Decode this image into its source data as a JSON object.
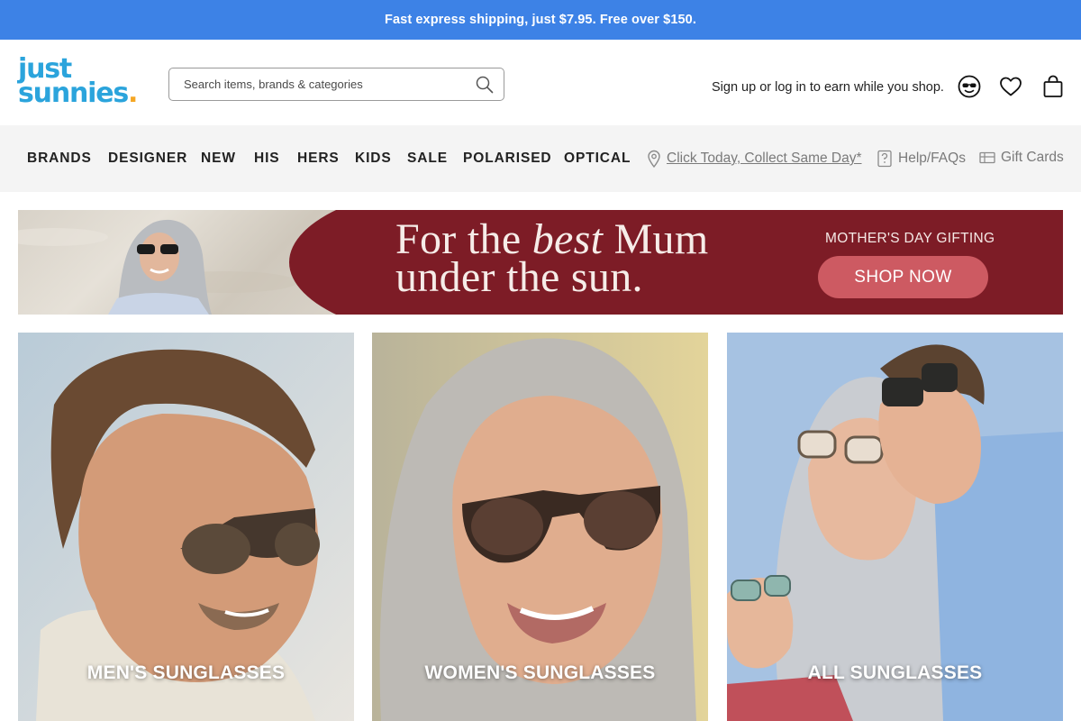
{
  "promo": {
    "text": "Fast express shipping, just $7.95. Free over $150."
  },
  "header": {
    "logo": {
      "line1": "just",
      "line2": "sunnies",
      "dot": "."
    },
    "search": {
      "placeholder": "Search items, brands & categories",
      "value": ""
    },
    "signup_text": "Sign up or log in to earn while you shop.",
    "icons": [
      "account-icon",
      "heart-icon",
      "bag-icon"
    ]
  },
  "nav": {
    "items": [
      "BRANDS",
      "DESIGNER",
      "NEW",
      "HIS",
      "HERS",
      "KIDS",
      "SALE",
      "POLARISED",
      "OPTICAL"
    ],
    "utility": [
      {
        "label": "Click Today, Collect Same Day*",
        "icon": "location-pin-icon"
      },
      {
        "label": "Help/FAQs",
        "icon": "help-doc-icon"
      },
      {
        "label": "Gift Cards",
        "icon": "gift-card-icon"
      }
    ]
  },
  "hero": {
    "line1_a": "For the ",
    "line1_b": "best",
    "line1_c": " Mum",
    "line2": "under the sun.",
    "gifting": "MOTHER'S DAY GIFTING",
    "cta": "SHOP NOW",
    "colors": {
      "background": "#7d1c26",
      "button": "#cd5a62"
    }
  },
  "tiles": [
    {
      "label": "MEN'S SUNGLASSES"
    },
    {
      "label": "WOMEN'S SUNGLASSES"
    },
    {
      "label": "ALL SUNGLASSES"
    }
  ],
  "colors": {
    "accent": "#3d82e6",
    "logo": "#2ba4dc",
    "logo_dot": "#f5a623"
  }
}
